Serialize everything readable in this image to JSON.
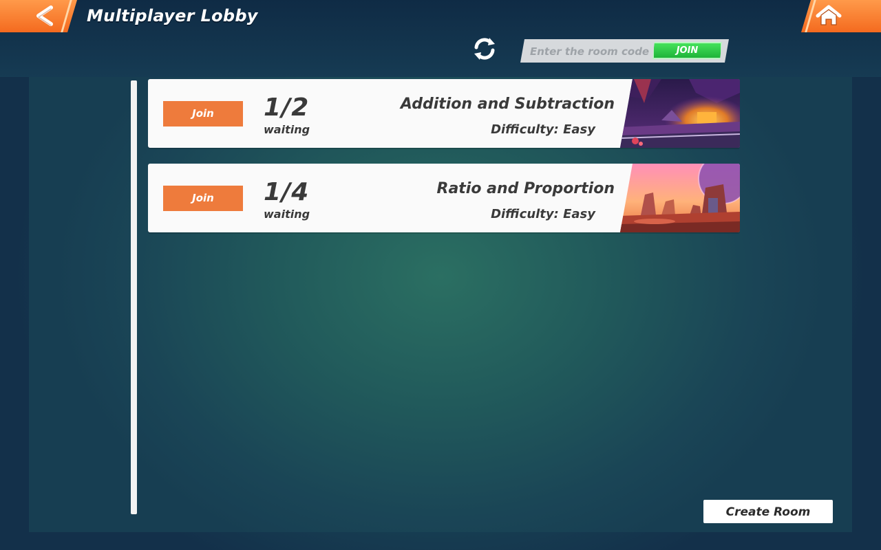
{
  "header": {
    "title": "Multiplayer Lobby",
    "back_icon": "back-arrow-icon",
    "home_icon": "home-icon"
  },
  "toolbar": {
    "refresh_icon": "refresh-icon",
    "room_code_placeholder": "Enter the room code",
    "room_code_value": "",
    "join_label": "JOIN"
  },
  "rooms": [
    {
      "join_label": "Join",
      "players": "1/2",
      "status": "waiting",
      "name": "Addition and Subtraction",
      "difficulty": "Difficulty: Easy",
      "thumbnail": "cave-scene"
    },
    {
      "join_label": "Join",
      "players": "1/4",
      "status": "waiting",
      "name": "Ratio and Proportion",
      "difficulty": "Difficulty: Easy",
      "thumbnail": "desert-planet-scene"
    }
  ],
  "footer": {
    "create_room_label": "Create Room"
  },
  "colors": {
    "accent_orange": "#ee7b3c",
    "join_green": "#2fc94a",
    "card_background": "#fafafa",
    "text_dark": "#3a3a3a"
  }
}
